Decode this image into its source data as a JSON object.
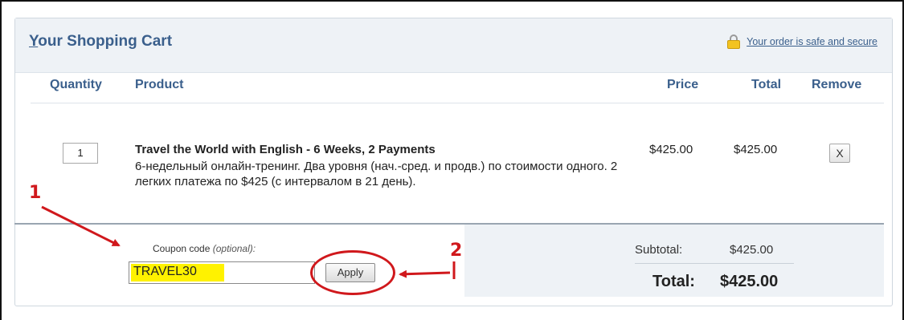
{
  "header": {
    "title_first": "Y",
    "title_rest": "our Shopping Cart",
    "secure_link": "Your order is safe and secure"
  },
  "table": {
    "columns": [
      "Quantity",
      "Product",
      "Price",
      "Total",
      "Remove"
    ],
    "row": {
      "quantity": "1",
      "product_title": "Travel the World with English - 6 Weeks, 2 Payments",
      "product_desc": "6-недельный онлайн-тренинг. Два уровня (нач.-сред. и продв.) по стоимости одного. 2 легких платежа по $425 (с интервалом в 21 день).",
      "price": "$425.00",
      "total": "$425.00",
      "remove_label": "X"
    }
  },
  "coupon": {
    "label": "Coupon code ",
    "label_optional": "(optional):",
    "value": "TRAVEL30",
    "apply_label": "Apply"
  },
  "summary": {
    "subtotal_label": "Subtotal:",
    "subtotal_value": "$425.00",
    "total_label": "Total:",
    "total_value": "$425.00"
  },
  "annotations": {
    "marker_1": "1",
    "marker_2": "2",
    "color": "#d0181c"
  },
  "colors": {
    "heading_blue": "#3a5f8c",
    "header_bg": "#eef2f6",
    "highlight": "#fff200"
  }
}
